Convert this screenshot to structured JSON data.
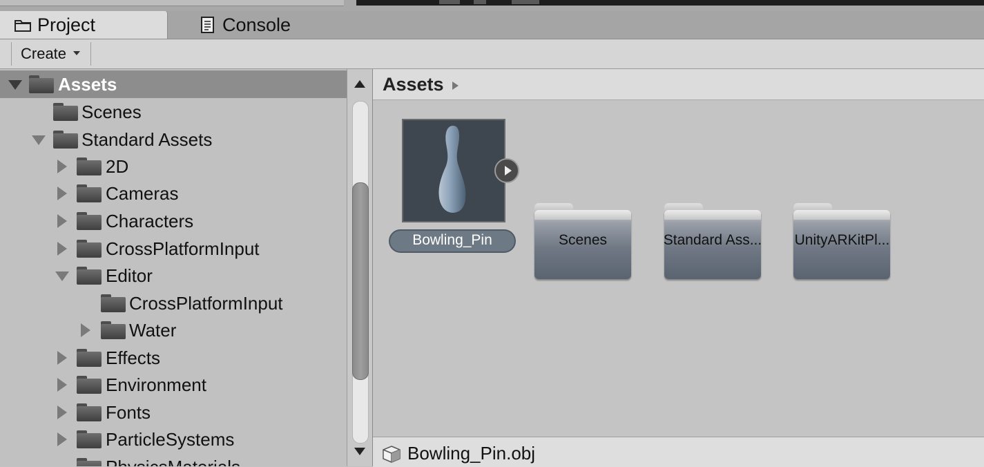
{
  "tabs": [
    {
      "label": "Project",
      "icon": "folder-icon",
      "active": true
    },
    {
      "label": "Console",
      "icon": "console-icon",
      "active": false
    }
  ],
  "toolbar": {
    "create_label": "Create"
  },
  "tree": [
    {
      "label": "Assets",
      "depth": 0,
      "expanded": true,
      "selected": true
    },
    {
      "label": "Scenes",
      "depth": 1,
      "expanded": null
    },
    {
      "label": "Standard Assets",
      "depth": 1,
      "expanded": true
    },
    {
      "label": "2D",
      "depth": 2,
      "expanded": false
    },
    {
      "label": "Cameras",
      "depth": 2,
      "expanded": false
    },
    {
      "label": "Characters",
      "depth": 2,
      "expanded": false
    },
    {
      "label": "CrossPlatformInput",
      "depth": 2,
      "expanded": false
    },
    {
      "label": "Editor",
      "depth": 2,
      "expanded": true
    },
    {
      "label": "CrossPlatformInput",
      "depth": 3,
      "expanded": null
    },
    {
      "label": "Water",
      "depth": 3,
      "expanded": false
    },
    {
      "label": "Effects",
      "depth": 2,
      "expanded": false
    },
    {
      "label": "Environment",
      "depth": 2,
      "expanded": false
    },
    {
      "label": "Fonts",
      "depth": 2,
      "expanded": false
    },
    {
      "label": "ParticleSystems",
      "depth": 2,
      "expanded": false
    },
    {
      "label": "PhysicsMaterials",
      "depth": 2,
      "expanded": null
    }
  ],
  "breadcrumb": {
    "path": "Assets"
  },
  "assets": [
    {
      "name": "Bowling_Pin",
      "kind": "model",
      "selected": true
    },
    {
      "name": "Scenes",
      "kind": "folder"
    },
    {
      "name": "Standard Ass...",
      "kind": "folder"
    },
    {
      "name": "UnityARKitPl...",
      "kind": "folder"
    }
  ],
  "status": {
    "filename": "Bowling_Pin.obj",
    "icon": "mesh-cube-icon"
  },
  "colors": {
    "panel_bg": "#c2c2c2",
    "selection": "#8d8d8d",
    "thumb_bg": "#3e464f",
    "pill": "#6d7a86"
  }
}
